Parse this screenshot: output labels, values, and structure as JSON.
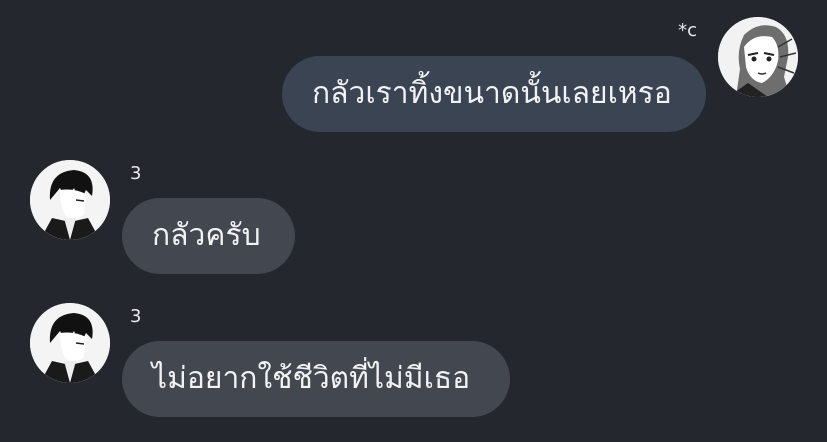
{
  "conversation": {
    "messages": [
      {
        "direction": "outgoing",
        "sender": "*c",
        "text": "กลัวเราทิ้งขนาดนั้นเลยเหรอ",
        "avatar_icon": "avatar-redhead-icon"
      },
      {
        "direction": "incoming",
        "sender": "3",
        "text": "กลัวครับ",
        "avatar_icon": "avatar-darkhair-icon"
      },
      {
        "direction": "incoming",
        "sender": "3",
        "text": "ไม่อยากใช้ชีวิตที่ไม่มีเธอ",
        "avatar_icon": "avatar-darkhair-icon"
      }
    ]
  },
  "colors": {
    "background": "#25272f",
    "outgoing_bubble": "#3a4453",
    "incoming_bubble": "#434750",
    "text": "#f2f2f4"
  }
}
